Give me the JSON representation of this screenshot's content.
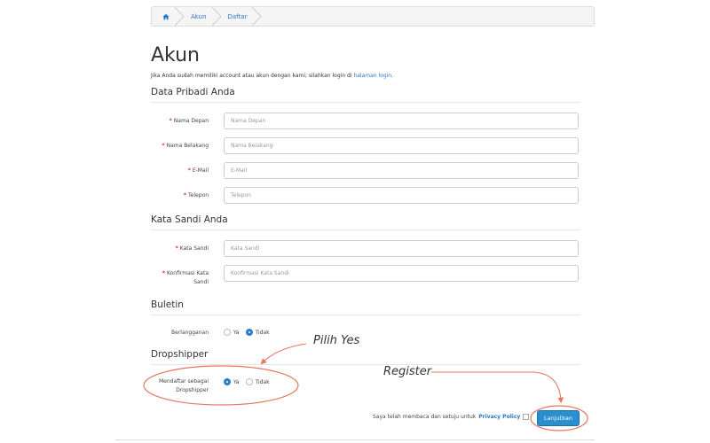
{
  "breadcrumb": {
    "home_icon": "home-icon",
    "items": [
      "Akun",
      "Daftar"
    ]
  },
  "page": {
    "title": "Akun",
    "intro_text": "Jika Anda sudah memiliki account atau akun dengan kami, silahkan login di",
    "intro_link": "halaman login",
    "intro_end": "."
  },
  "sections": {
    "personal": "Data Pribadi Anda",
    "password": "Kata Sandi Anda",
    "newsletter": "Buletin",
    "dropshipper": "Dropshipper"
  },
  "fields": {
    "first_name": {
      "label": "Nama Depan",
      "placeholder": "Nama Depan",
      "value": ""
    },
    "last_name": {
      "label": "Nama Belakang",
      "placeholder": "Nama Belakang",
      "value": ""
    },
    "email": {
      "label": "E-Mail",
      "placeholder": "E-Mail",
      "value": ""
    },
    "phone": {
      "label": "Telepon",
      "placeholder": "Telepon",
      "value": ""
    },
    "password": {
      "label": "Kata Sandi",
      "placeholder": "Kata Sandi",
      "value": ""
    },
    "confirm": {
      "label_line1": "Konfirmasi Kata",
      "label_line2": "Sandi",
      "placeholder": "Konfirmasi Kata Sandi",
      "value": ""
    }
  },
  "required_mark": "*",
  "newsletter": {
    "label": "Berlangganan",
    "options": [
      "Ya",
      "Tidak"
    ],
    "selected": "Tidak"
  },
  "dropshipper": {
    "label_line1": "Mendaftar sebagai",
    "label_line2": "Dropshipper",
    "options": [
      "Ya",
      "Tidak"
    ],
    "selected": "Ya"
  },
  "annotations": {
    "pilih_yes": "Pilih Yes",
    "register": "Register",
    "color": "#e8755c"
  },
  "footer": {
    "agree_text": "Saya telah membaca dan setuju untuk",
    "privacy_link": "Privacy Policy",
    "continue_label": "Lanjutkan"
  },
  "colors": {
    "accent": "#2a8fcf",
    "link": "#2a77c9",
    "required": "#d9232d"
  }
}
